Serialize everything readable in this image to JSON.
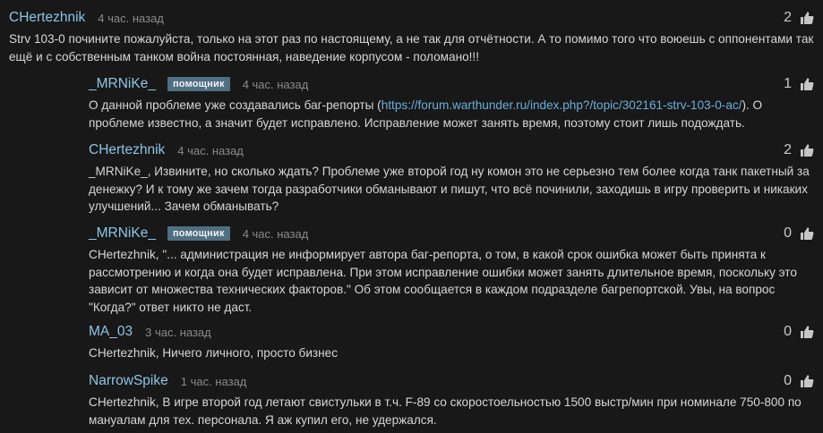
{
  "comments": [
    {
      "author": "CHertezhnik",
      "time": "4 час. назад",
      "score": "2",
      "text": "Strv 103-0 почините пожалуйста, только на этот раз по настоящему, а не так для отчётности. А то помимо того что воюешь с оппонентами так ещё и с собственным танком война постоянная, наведение корпусом - поломано!!!"
    },
    {
      "author": "_MRNiKe_",
      "badge": "помощник",
      "time": "4 час. назад",
      "score": "1",
      "text_before": "О данной проблеме уже создавались баг-репорты (",
      "link": "https://forum.warthunder.ru/index.php?/topic/302161-strv-103-0-ac/",
      "text_after": "). О проблеме известно, а значит будет исправлено. Исправление может занять время, поэтому стоит лишь подождать."
    },
    {
      "author": "CHertezhnik",
      "time": "4 час. назад",
      "score": "2",
      "text": "_MRNiKe_, Извините, но сколько ждать? Проблеме уже второй год ну комон это не серьезно тем более когда танк пакетный за денежку? И к тому же зачем тогда разработчики обманывают и пишут, что всё починили, заходишь в игру проверить и никаких улучшений... Зачем обманывать?"
    },
    {
      "author": "_MRNiKe_",
      "badge": "помощник",
      "time": "4 час. назад",
      "score": "0",
      "text": "CHertezhnik, \"... администрация не информирует автора баг-репорта, о том, в какой срок ошибка может быть принята к рассмотрению и когда она будет исправлена. При этом исправление ошибки может занять длительное время, поскольку это зависит от множества технических факторов.\" Об этом сообщается в каждом подразделе багрепортской. Увы, на вопрос \"Когда?\" ответ никто не даст."
    },
    {
      "author": "MA_03",
      "time": "3 час. назад",
      "score": "0",
      "text": "CHertezhnik, Ничего личного, просто бизнес"
    },
    {
      "author": "NarrowSpike",
      "time": "1 час. назад",
      "score": "0",
      "text": "CHertezhnik, В игре второй год летают свистульки в т.ч. F-89 со скоростоельностью 1500 выстр/мин при номинале 750-800 по мануалам для тех. персонала. Я аж купил его, не удержался."
    }
  ],
  "icons": {
    "like": "thumbs-up-icon"
  },
  "colors": {
    "background": "#181818",
    "author": "#8ec5e6",
    "badge": "#4f6f82",
    "link": "#6aaedb",
    "text": "#d6d6d6",
    "muted": "#8a8a8a"
  }
}
